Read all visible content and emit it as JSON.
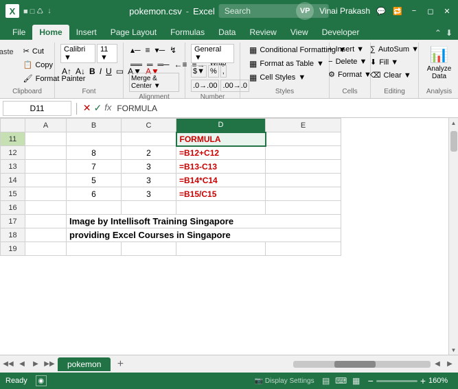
{
  "titlebar": {
    "filename": "pokemon.csv",
    "user_initials": "VP",
    "user_name": "Vinai Prakash",
    "search_placeholder": "Search"
  },
  "ribbon_tabs": [
    {
      "label": "File",
      "active": false
    },
    {
      "label": "Home",
      "active": true
    },
    {
      "label": "Insert",
      "active": false
    },
    {
      "label": "Page Layout",
      "active": false
    },
    {
      "label": "Formulas",
      "active": false
    },
    {
      "label": "Data",
      "active": false
    },
    {
      "label": "Review",
      "active": false
    },
    {
      "label": "View",
      "active": false
    },
    {
      "label": "Developer",
      "active": false
    }
  ],
  "ribbon": {
    "clipboard_label": "Clipboard",
    "font_label": "Font",
    "alignment_label": "Alignment",
    "number_label": "Number",
    "styles_label": "Styles",
    "cells_label": "Cells",
    "editing_label": "Editing",
    "analysis_label": "Analysis",
    "conditional_formatting": "Conditional Formatting",
    "format_as_table": "Format as Table",
    "cell_styles": "Cell Styles",
    "cells_btn": "Cells",
    "editing_btn": "Editing",
    "analyze_data": "Analyze Data"
  },
  "formula_bar": {
    "cell_ref": "D11",
    "formula": "FORMULA"
  },
  "grid": {
    "col_headers": [
      "",
      "A",
      "B",
      "C",
      "D",
      "E"
    ],
    "rows": [
      {
        "row_num": "11",
        "a": "",
        "b": "",
        "c": "",
        "d": "FORMULA",
        "e": "",
        "d_class": "cell-formula"
      },
      {
        "row_num": "12",
        "a": "",
        "b": "8",
        "c": "2",
        "d": "=B12+C12",
        "e": "",
        "d_class": "cell-formula"
      },
      {
        "row_num": "13",
        "a": "",
        "b": "7",
        "c": "3",
        "d": "=B13-C13",
        "e": "",
        "d_class": "cell-formula"
      },
      {
        "row_num": "14",
        "a": "",
        "b": "5",
        "c": "3",
        "d": "=B14*C14",
        "e": "",
        "d_class": "cell-formula"
      },
      {
        "row_num": "15",
        "a": "",
        "b": "6",
        "c": "3",
        "d": "=B15/C15",
        "e": "",
        "d_class": "cell-formula"
      },
      {
        "row_num": "16",
        "a": "",
        "b": "",
        "c": "",
        "d": "",
        "e": "",
        "d_class": ""
      },
      {
        "row_num": "17",
        "a": "",
        "b": "Image by Intellisoft Training Singapore",
        "c": "",
        "d": "",
        "e": "",
        "d_class": ""
      },
      {
        "row_num": "18",
        "a": "",
        "b": "providing Excel Courses in Singapore",
        "c": "",
        "d": "",
        "e": "",
        "d_class": ""
      },
      {
        "row_num": "19",
        "a": "",
        "b": "",
        "c": "",
        "d": "",
        "e": "",
        "d_class": ""
      }
    ]
  },
  "sheet_tab": "pokemon",
  "status_bar": {
    "ready": "Ready",
    "zoom": "160%"
  }
}
